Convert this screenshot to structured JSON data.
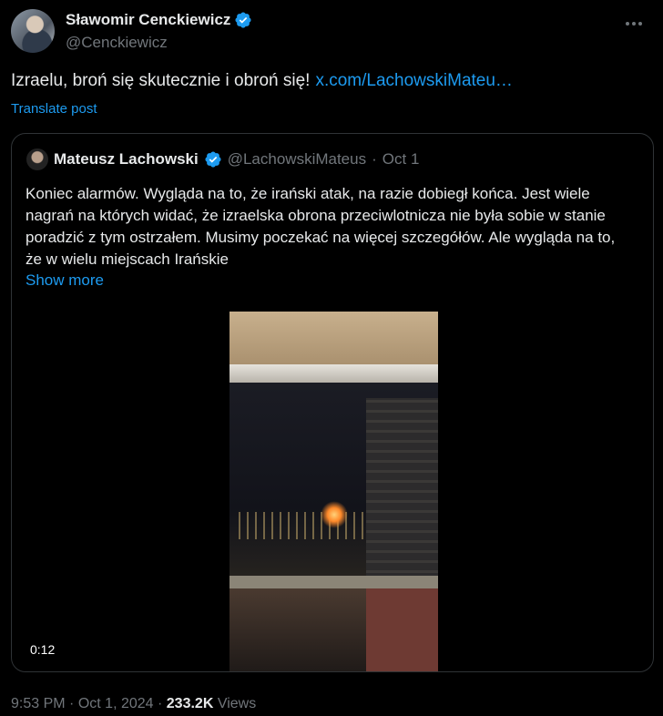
{
  "author": {
    "name": "Sławomir Cenckiewicz",
    "handle": "@Cenckiewicz"
  },
  "tweet": {
    "text": "Izraelu, broń się skutecznie i obroń się!",
    "link": "x.com/LachowskiMateu…",
    "translate": "Translate post"
  },
  "quote": {
    "name": "Mateusz Lachowski",
    "handle": "@LachowskiMateus",
    "separator": "·",
    "date": "Oct 1",
    "text": "Koniec alarmów. Wygląda na to, że irański atak, na razie dobiegł końca. Jest wiele nagrań na których widać, że izraelska obrona przeciwlotnicza nie była sobie w stanie poradzić z tym ostrzałem. Musimy poczekać na więcej szczegółów. Ale wygląda na to, że w wielu miejscach Irańskie",
    "show_more": "Show more",
    "video_time": "0:12"
  },
  "meta": {
    "time": "9:53 PM",
    "date": "Oct 1, 2024",
    "views": "233.2K",
    "views_label": "Views",
    "sep": "·"
  },
  "colors": {
    "accent": "#1d9bf0",
    "muted": "#71767b",
    "text": "#e7e9ea",
    "background": "#000000"
  }
}
